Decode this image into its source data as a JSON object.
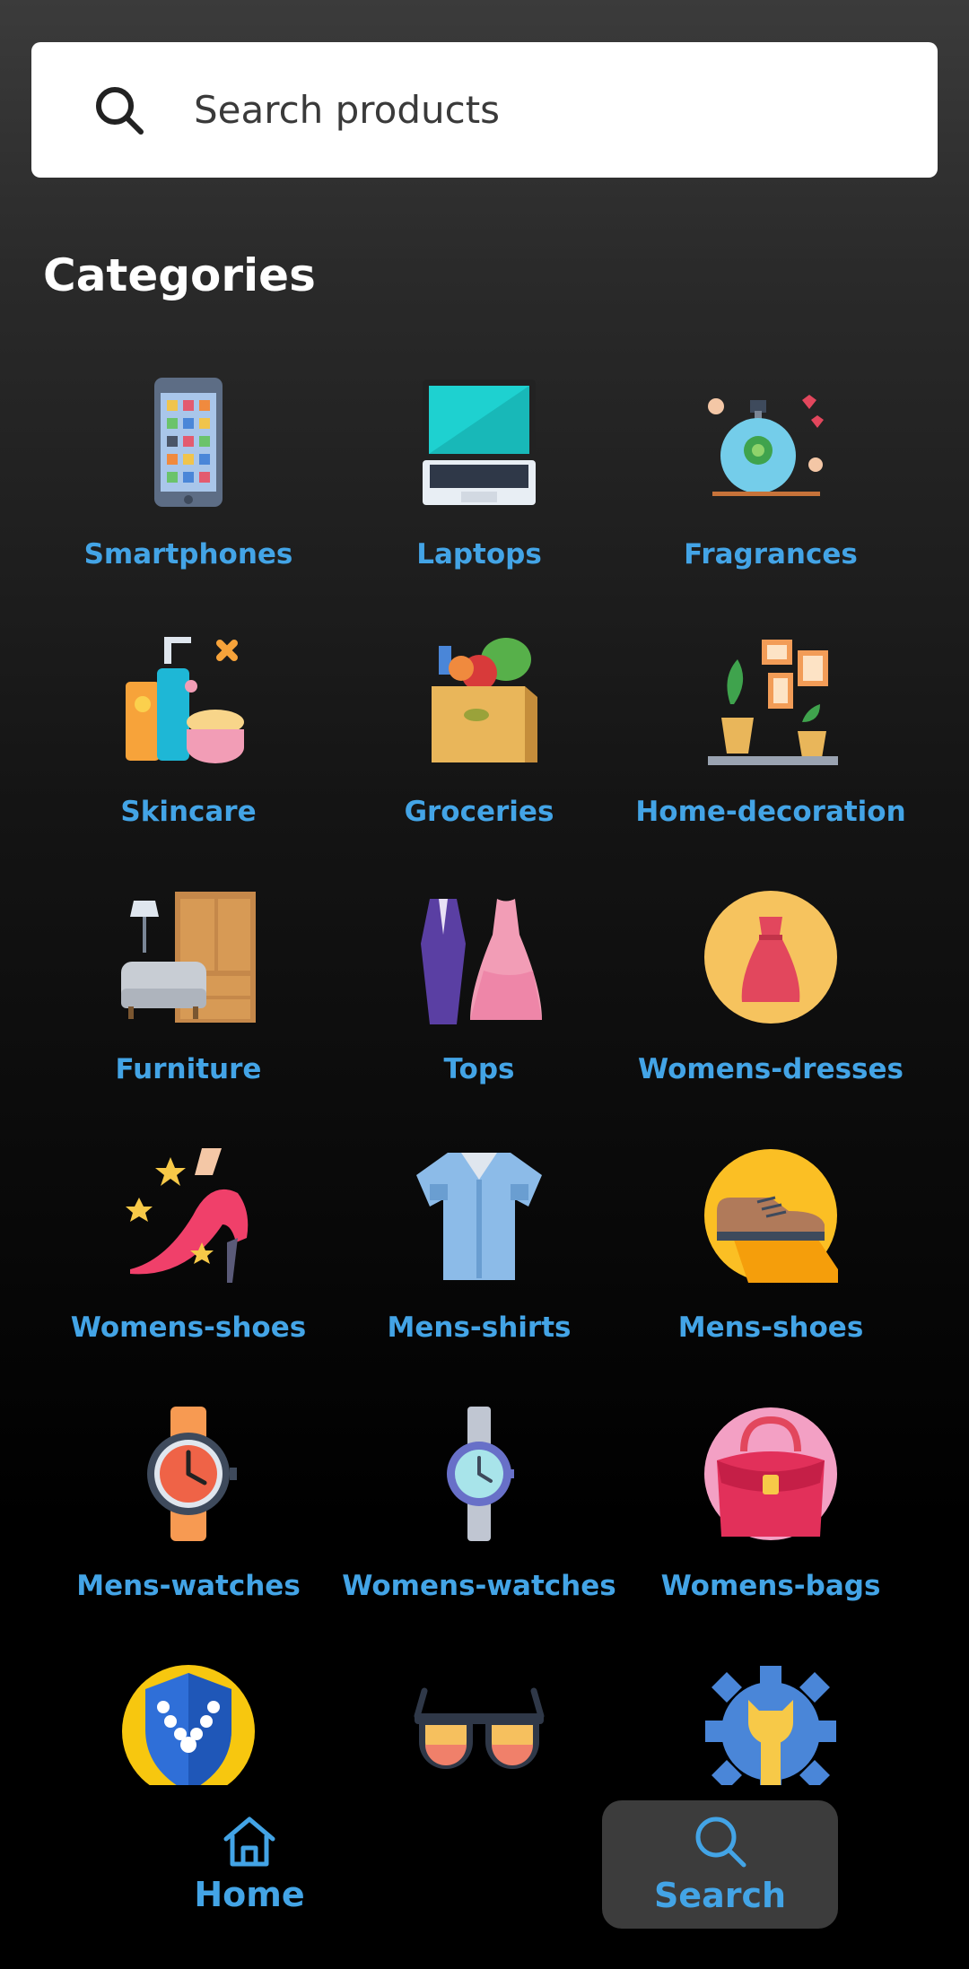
{
  "search": {
    "placeholder": "Search products",
    "value": ""
  },
  "categories_title": "Categories",
  "categories": [
    {
      "label": "Smartphones",
      "icon": "smartphone-icon"
    },
    {
      "label": "Laptops",
      "icon": "laptop-icon"
    },
    {
      "label": "Fragrances",
      "icon": "perfume-icon"
    },
    {
      "label": "Skincare",
      "icon": "skincare-icon"
    },
    {
      "label": "Groceries",
      "icon": "grocery-bag-icon"
    },
    {
      "label": "Home-decoration",
      "icon": "home-decor-icon"
    },
    {
      "label": "Furniture",
      "icon": "furniture-icon"
    },
    {
      "label": "Tops",
      "icon": "dress-suit-icon"
    },
    {
      "label": "Womens-dresses",
      "icon": "red-dress-icon"
    },
    {
      "label": "Womens-shoes",
      "icon": "high-heel-icon"
    },
    {
      "label": "Mens-shirts",
      "icon": "shirt-icon"
    },
    {
      "label": "Mens-shoes",
      "icon": "mens-shoe-icon"
    },
    {
      "label": "Mens-watches",
      "icon": "orange-watch-icon"
    },
    {
      "label": "Womens-watches",
      "icon": "purple-watch-icon"
    },
    {
      "label": "Womens-bags",
      "icon": "handbag-icon"
    },
    {
      "label": "",
      "icon": "necklace-shield-icon"
    },
    {
      "label": "",
      "icon": "sunglasses-icon"
    },
    {
      "label": "",
      "icon": "gear-wrench-icon"
    }
  ],
  "nav": {
    "home_label": "Home",
    "search_label": "Search",
    "active": "Search"
  },
  "colors": {
    "accent": "#43a4e6",
    "search_bg": "#ffffff",
    "nav_active_bg": "#3c3c3c"
  }
}
